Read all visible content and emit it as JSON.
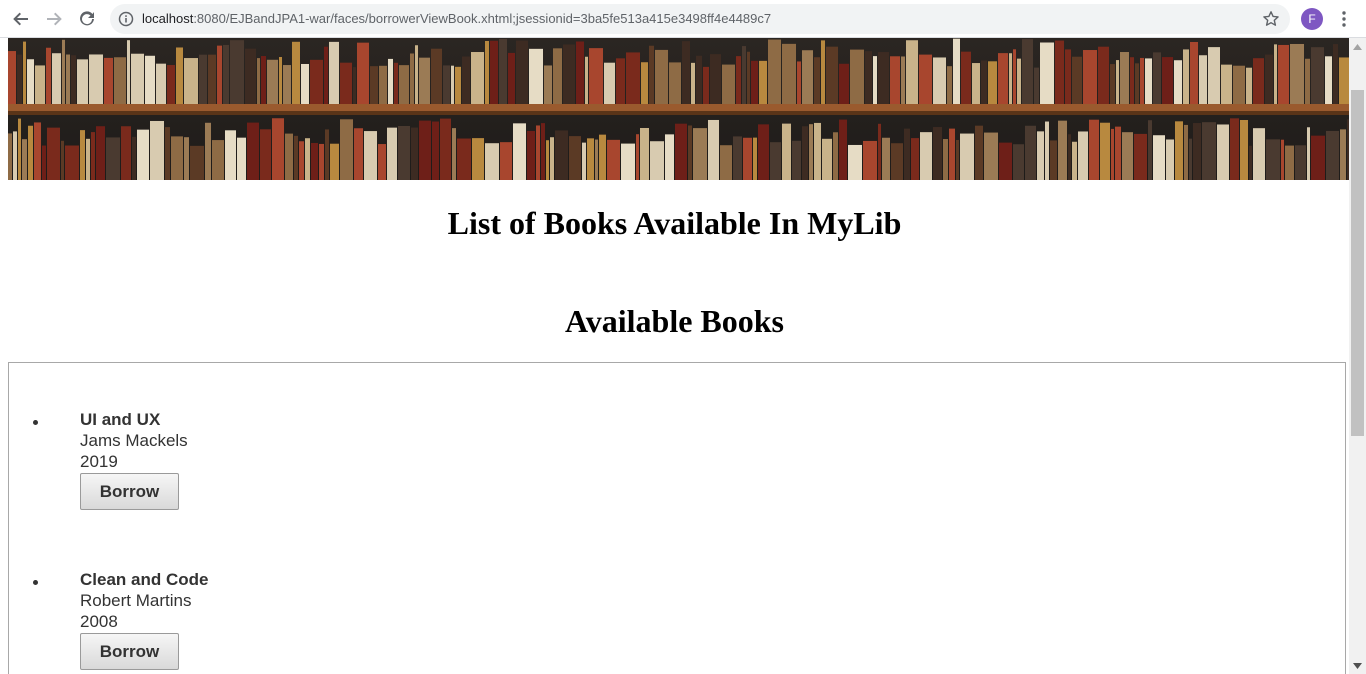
{
  "browser": {
    "url_host": "localhost",
    "url_rest": ":8080/EJBandJPA1-war/faces/borrowerViewBook.xhtml;jsessionid=3ba5fe513a415e3498ff4e4489c7",
    "avatar_letter": "F",
    "icons": [
      "back-arrow-icon",
      "forward-arrow-icon",
      "reload-icon",
      "info-icon",
      "star-icon",
      "menu-dots-icon"
    ]
  },
  "page": {
    "heading": "List of Books Available In MyLib",
    "subheading": "Available Books"
  },
  "books": [
    {
      "title": "UI and UX",
      "author": "Jams Mackels",
      "year": "2019",
      "button": "Borrow"
    },
    {
      "title": "Clean and Code",
      "author": "Robert Martins",
      "year": "2008",
      "button": "Borrow"
    }
  ],
  "colors": {
    "avatar": "#7e57c2",
    "text": "#333333"
  }
}
